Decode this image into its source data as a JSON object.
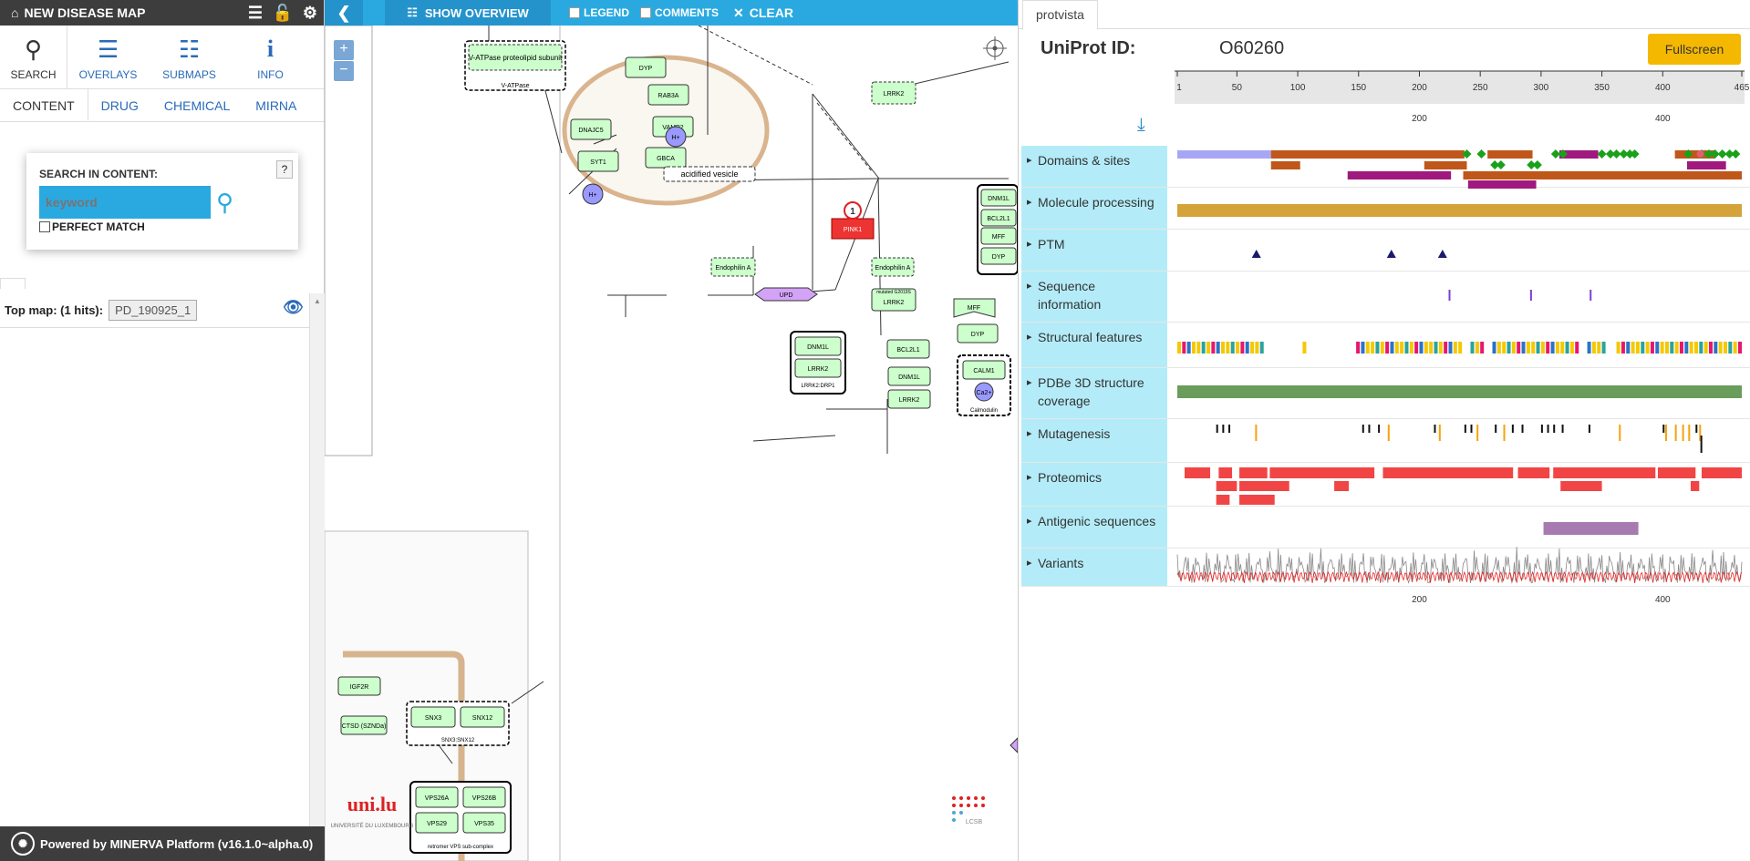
{
  "header": {
    "app_title": "NEW DISEASE MAP"
  },
  "nav": {
    "items": [
      {
        "label": "SEARCH",
        "icon": "search-icon"
      },
      {
        "label": "OVERLAYS",
        "icon": "list-icon"
      },
      {
        "label": "SUBMAPS",
        "icon": "sitemap-icon"
      },
      {
        "label": "INFO",
        "icon": "info-icon"
      }
    ]
  },
  "tabs": [
    "CONTENT",
    "DRUG",
    "CHEMICAL",
    "MIRNA"
  ],
  "search": {
    "heading": "SEARCH IN CONTENT:",
    "placeholder": "keyword",
    "perfect_match": "PERFECT MATCH",
    "help": "?"
  },
  "results": {
    "label": "Top map: (1 hits):",
    "chip": "PD_190925_1"
  },
  "footer": {
    "text": "Powered by MINERVA Platform (v16.1.0~alpha.0)"
  },
  "map_toolbar": {
    "overview": "SHOW OVERVIEW",
    "legend": "LEGEND",
    "comments": "COMMENTS",
    "clear": "CLEAR"
  },
  "map": {
    "nodes": [
      "V-ATPase proteolipid subunit",
      "V-ATPase",
      "DYP",
      "RAB3A",
      "VAMP2",
      "DNAJC5",
      "SYT1",
      "GBCA",
      "H+",
      "acidified vesicle",
      "LRRK2",
      "PINK1",
      "Endophilin A",
      "UPD",
      "Endophilin A",
      "mutated G2019S",
      "LRRK2",
      "DNM1L",
      "BCL2L1",
      "MFF",
      "DYP",
      "MFF",
      "DYP",
      "BCL2L1",
      "DNM1L",
      "LRRK2",
      "DNM1L",
      "LRRK2",
      "LRRK2:DRP1",
      "CALM1",
      "Ca2+",
      "Calmodulin",
      "IGF2R",
      "CTSD (SZNDa)",
      "SNX3",
      "SNX12",
      "SNX3:SNX12",
      "VPS26A",
      "VPS26B",
      "VPS29",
      "VPS35",
      "retromer VPS sub-complex"
    ],
    "marker_label": "1",
    "watermark_lux": "UNIVERSITÉ DU LUXEMBOURG",
    "watermark_lcsb": "LCSB"
  },
  "protvista": {
    "tab": "protvista",
    "uniprot_label": "UniProt ID:",
    "uniprot_id": "O60260",
    "fullscreen": "Fullscreen",
    "length": 465,
    "ticks": [
      "1",
      "50",
      "100",
      "150",
      "200",
      "250",
      "300",
      "350",
      "400",
      "465"
    ],
    "subticks": [
      "200",
      "400"
    ],
    "tracks": [
      "Domains & sites",
      "Molecule processing",
      "PTM",
      "Sequence information",
      "Structural features",
      "PDBe 3D structure coverage",
      "Mutagenesis",
      "Proteomics",
      "Antigenic sequences",
      "Variants"
    ],
    "colors": {
      "track_label_bg": "#b3ecf8",
      "domain_brown": "#c0571a",
      "domain_purple": "#a0197e",
      "domain_lavender": "#a7a6f5",
      "site_green": "#1aa11a",
      "chain_gold": "#d4a33a",
      "ptm_navy": "#1a1a6b",
      "seq_purple": "#7b3fd1",
      "pdbe_green": "#6a9c5c",
      "proteomics_red": "#f14545",
      "antigenic_violet": "#a77bb0"
    }
  }
}
